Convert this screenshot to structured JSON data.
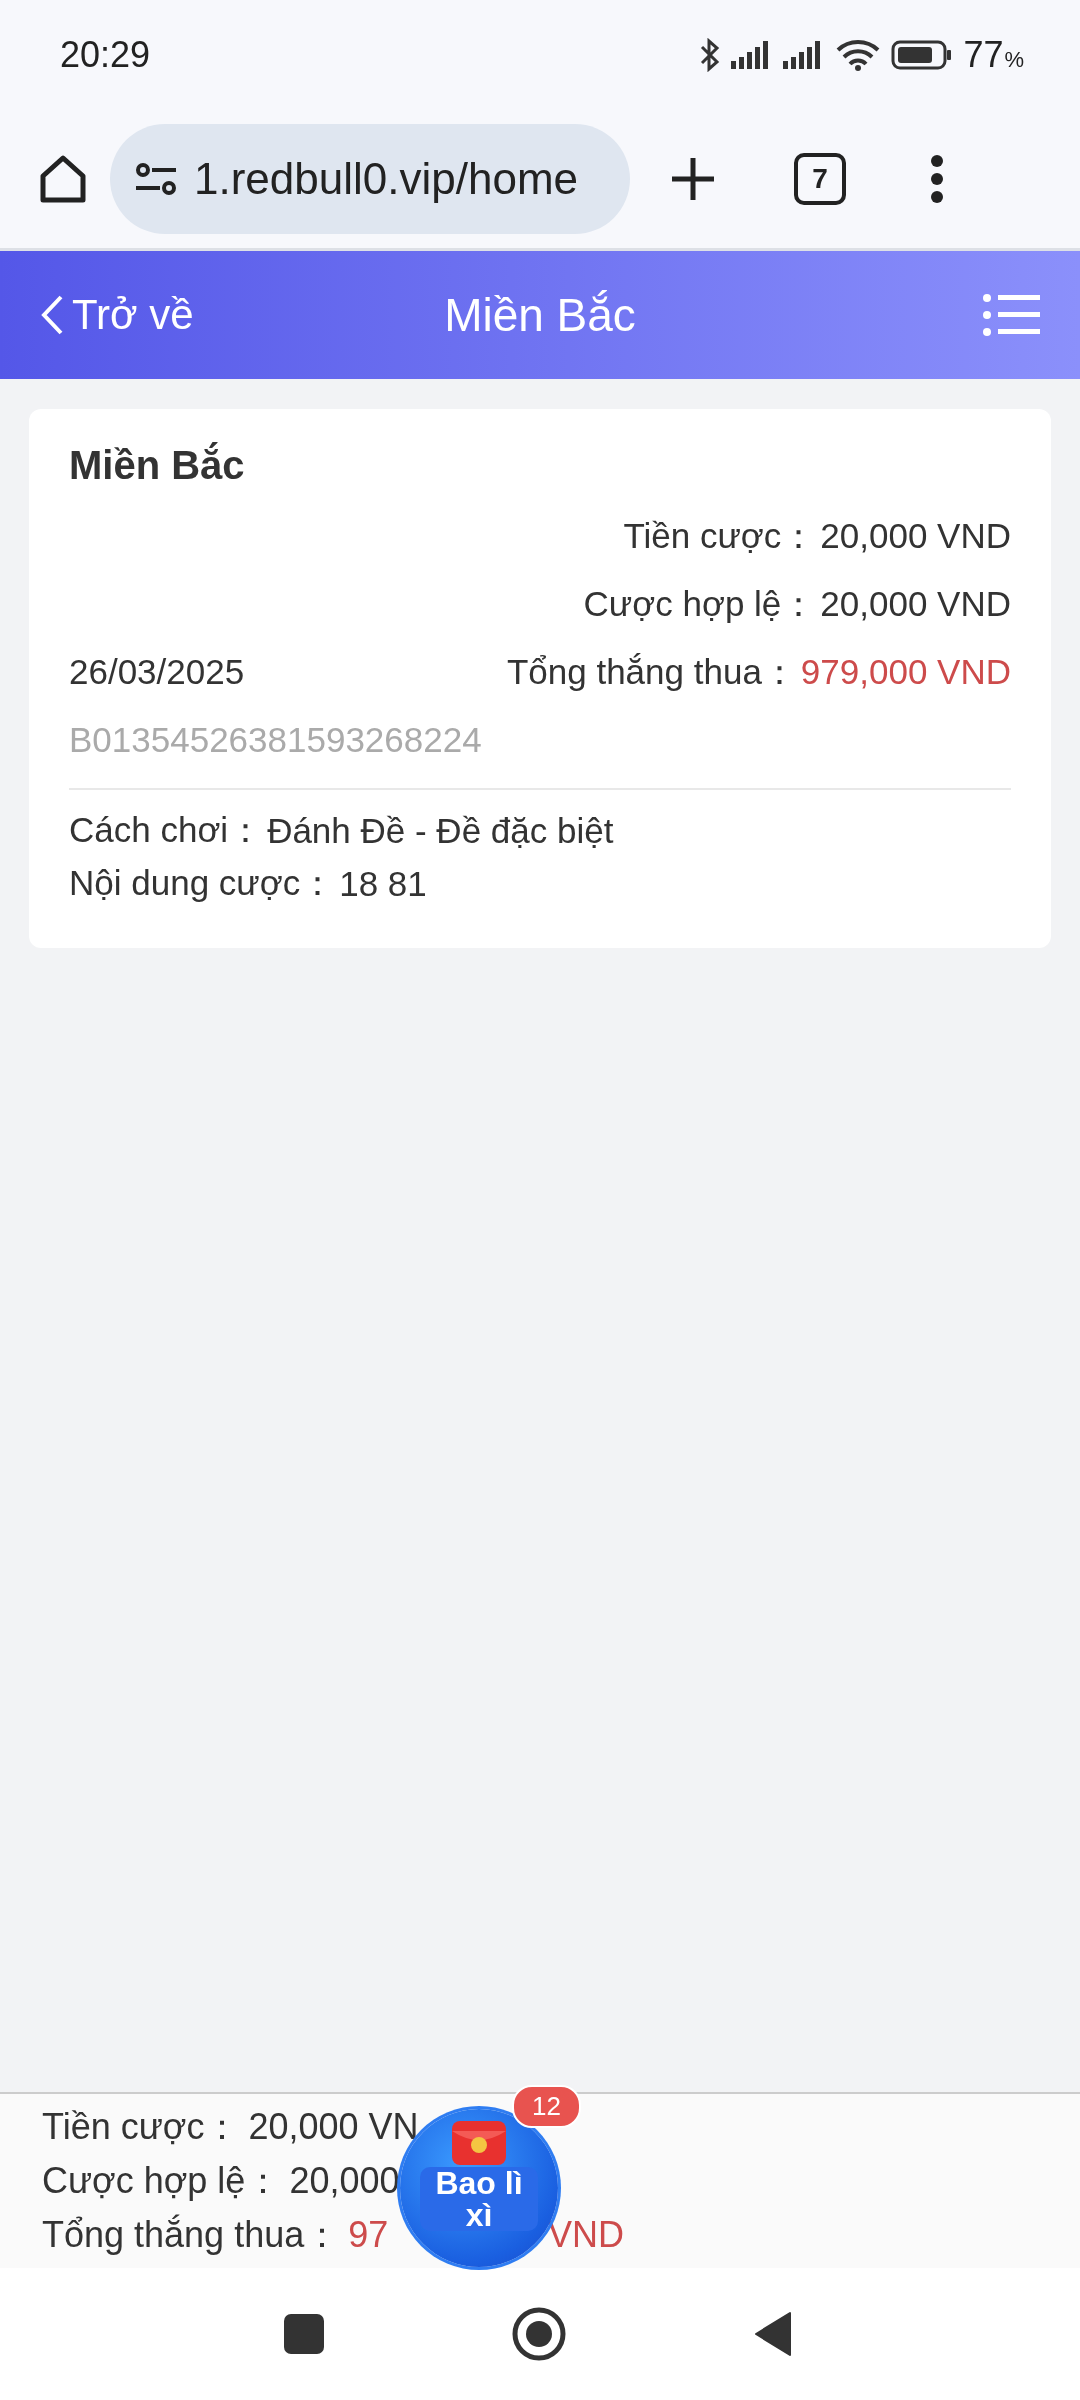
{
  "status_bar": {
    "time": "20:29",
    "battery": "77",
    "battery_unit": "%"
  },
  "browser": {
    "url": "1.redbull0.vip/home",
    "tab_count": "7"
  },
  "header": {
    "back": "Trở về",
    "title": "Miền Bắc"
  },
  "bet": {
    "title": "Miền Bắc",
    "date": "26/03/2025",
    "id": "B01354526381593268224",
    "amounts": [
      {
        "label": "Tiền cược：",
        "value": "20,000 VND",
        "kind": "plain"
      },
      {
        "label": "Cược hợp lệ：",
        "value": "20,000 VND",
        "kind": "plain"
      },
      {
        "label": "Tổng thắng thua：",
        "value": "979,000 VND",
        "kind": "result"
      }
    ],
    "details": [
      {
        "label": "Cách chơi：",
        "value": "Đánh Đề - Đề đặc biệt"
      },
      {
        "label": "Nội dung cược：",
        "value": "18 81"
      }
    ]
  },
  "summary": [
    {
      "label": "Tiền cược：",
      "value": "20,000 VN",
      "kind": "plain"
    },
    {
      "label": "Cược hợp lệ：",
      "value": "20,000",
      "kind": "plain"
    },
    {
      "label": "Tổng thắng thua：",
      "value": "97",
      "value_after": "VND",
      "kind": "result"
    }
  ],
  "red_envelope": {
    "label": "Bao lì xì",
    "badge": "12"
  }
}
